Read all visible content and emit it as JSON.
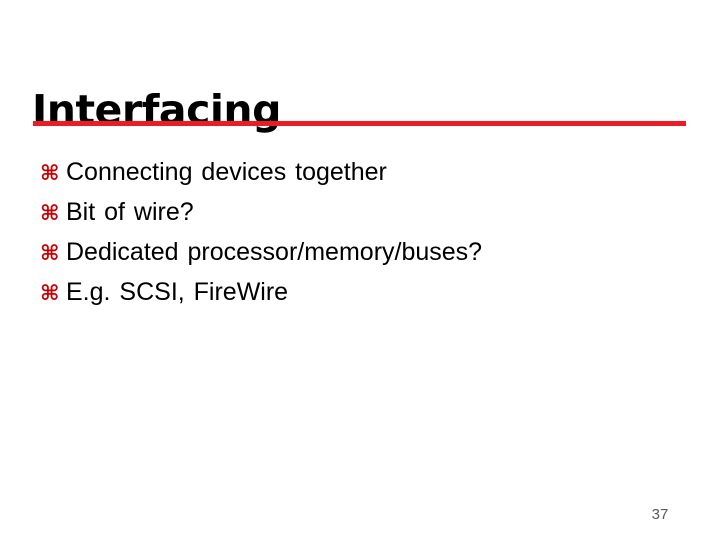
{
  "slide": {
    "title": "Interfacing",
    "accent_color": "#ED1C24",
    "bullet_color": "#CC0000",
    "background_color": "#FFFFFF",
    "text_color": "#000000",
    "bullet_glyph": "⌘",
    "bullet_glyph_name": "place-of-interest-icon",
    "bullets": [
      {
        "text": "Connecting devices together"
      },
      {
        "text": "Bit of wire?"
      },
      {
        "text": "Dedicated processor/memory/buses?"
      },
      {
        "text": "E.g. SCSI, FireWire"
      }
    ],
    "page_number": "37"
  }
}
